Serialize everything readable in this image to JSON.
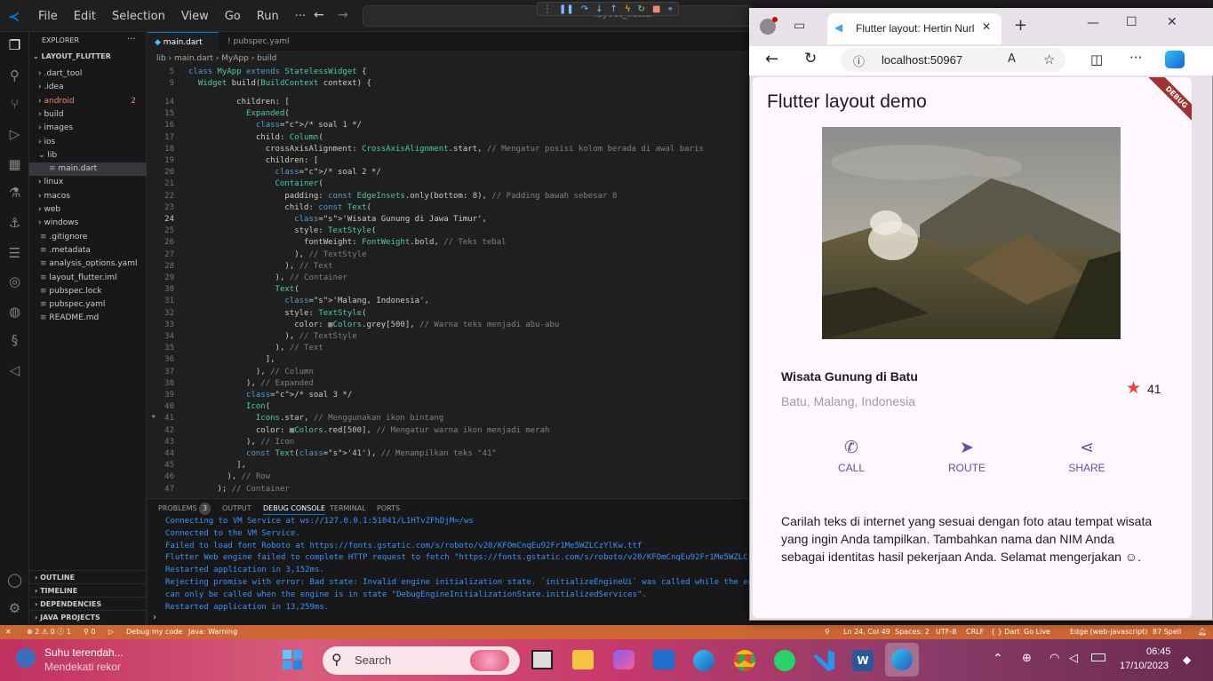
{
  "vscode": {
    "menu": [
      "File",
      "Edit",
      "Selection",
      "View",
      "Go",
      "Run",
      "···"
    ],
    "command_center": "layout_flutter",
    "explorer_title": "EXPLORER",
    "project": "LAYOUT_FLUTTER",
    "tree": [
      {
        "label": ".dart_tool",
        "kind": "folder"
      },
      {
        "label": ".idea",
        "kind": "folder"
      },
      {
        "label": "android",
        "kind": "folder",
        "badge": "2",
        "color": "#f48771"
      },
      {
        "label": "build",
        "kind": "folder"
      },
      {
        "label": "images",
        "kind": "folder"
      },
      {
        "label": "ios",
        "kind": "folder"
      },
      {
        "label": "lib",
        "kind": "folder-open"
      },
      {
        "label": "main.dart",
        "kind": "file-active"
      },
      {
        "label": "linux",
        "kind": "folder"
      },
      {
        "label": "macos",
        "kind": "folder"
      },
      {
        "label": "web",
        "kind": "folder"
      },
      {
        "label": "windows",
        "kind": "folder"
      },
      {
        "label": ".gitignore",
        "kind": "file"
      },
      {
        "label": ".metadata",
        "kind": "file"
      },
      {
        "label": "analysis_options.yaml",
        "kind": "file"
      },
      {
        "label": "layout_flutter.iml",
        "kind": "file"
      },
      {
        "label": "pubspec.lock",
        "kind": "file"
      },
      {
        "label": "pubspec.yaml",
        "kind": "file"
      },
      {
        "label": "README.md",
        "kind": "file"
      }
    ],
    "sections": [
      "OUTLINE",
      "TIMELINE",
      "DEPENDENCIES",
      "JAVA PROJECTS"
    ],
    "tabs": [
      {
        "label": "main.dart",
        "active": true
      },
      {
        "label": "pubspec.yaml",
        "active": false
      }
    ],
    "breadcrumbs": "lib  ›  main.dart  ›  MyApp  ›  build",
    "sticky": [
      {
        "n": "5",
        "text": "class MyApp extends StatelessWidget {"
      },
      {
        "n": "9",
        "text": "  Widget build(BuildContext context) {"
      }
    ],
    "code": [
      {
        "n": "14",
        "text": "          children: ["
      },
      {
        "n": "15",
        "text": "            Expanded("
      },
      {
        "n": "16",
        "text": "              /* soal 1 */"
      },
      {
        "n": "17",
        "text": "              child: Column("
      },
      {
        "n": "18",
        "text": "                crossAxisAlignment: CrossAxisAlignment.start, // Mengatur posisi kolom berada di awal baris"
      },
      {
        "n": "19",
        "text": "                children: ["
      },
      {
        "n": "20",
        "text": "                  /* soal 2 */"
      },
      {
        "n": "21",
        "text": "                  Container("
      },
      {
        "n": "22",
        "text": "                    padding: const EdgeInsets.only(bottom: 8), // Padding bawah sebesar 8"
      },
      {
        "n": "23",
        "text": "                    child: const Text("
      },
      {
        "n": "24",
        "text": "                      'Wisata Gunung di Jawa Timur',"
      },
      {
        "n": "25",
        "text": "                      style: TextStyle("
      },
      {
        "n": "26",
        "text": "                        fontWeight: FontWeight.bold, // Teks tebal"
      },
      {
        "n": "27",
        "text": "                      ), // TextStyle"
      },
      {
        "n": "28",
        "text": "                    ), // Text"
      },
      {
        "n": "29",
        "text": "                  ), // Container"
      },
      {
        "n": "30",
        "text": "                  Text("
      },
      {
        "n": "31",
        "text": "                    'Malang, Indonesia',"
      },
      {
        "n": "32",
        "text": "                    style: TextStyle("
      },
      {
        "n": "33",
        "text": "                      color: ■Colors.grey[500], // Warna teks menjadi abu-abu"
      },
      {
        "n": "34",
        "text": "                    ), // TextStyle"
      },
      {
        "n": "35",
        "text": "                  ), // Text"
      },
      {
        "n": "36",
        "text": "                ],"
      },
      {
        "n": "37",
        "text": "              ), // Column"
      },
      {
        "n": "38",
        "text": "            ), // Expanded"
      },
      {
        "n": "39",
        "text": "            /* soal 3 */"
      },
      {
        "n": "40",
        "text": "            Icon("
      },
      {
        "n": "41",
        "text": "              Icons.star, // Menggunakan ikon bintang"
      },
      {
        "n": "42",
        "text": "              color: ■Colors.red[500], // Mengatur warna ikon menjadi merah"
      },
      {
        "n": "43",
        "text": "            ), // Icon"
      },
      {
        "n": "44",
        "text": "            const Text('41'), // Menampilkan teks \"41\""
      },
      {
        "n": "45",
        "text": "          ],"
      },
      {
        "n": "46",
        "text": "        ), // Row"
      },
      {
        "n": "47",
        "text": "      ); // Container"
      }
    ],
    "panel_tabs": [
      "PROBLEMS",
      "3",
      "OUTPUT",
      "DEBUG CONSOLE",
      "TERMINAL",
      "PORTS"
    ],
    "console": [
      "Connecting to VM Service at ws://127.0.0.1:51041/L1HTvZFhDjM=/ws",
      "Connected to the VM Service.",
      "Failed to load font Roboto at https://fonts.gstatic.com/s/roboto/v20/KFOmCnqEu92Fr1Me5WZLCzYlKw.ttf",
      "Flutter Web engine failed to complete HTTP request to fetch \"https://fonts.gstatic.com/s/roboto/v20/KFOmCnqEu92Fr1Me5WZLCzYl",
      "Restarted application in 3,152ms.",
      "Rejecting promise with error: Bad state: Invalid engine initialization state. `initializeEngineUi` was called while the eng",
      "can only be called when the engine is in state \"DebugEngineInitializationState.initializedServices\".",
      "Restarted application in 13,259ms."
    ],
    "status": {
      "errors": "⊗ 2 ⚠ 0 ⓘ 1",
      "ports": "⚲ 0",
      "debug": "Debug my code",
      "java": "Java: Warning",
      "position": "Ln 24, Col 49",
      "spaces": "Spaces: 2",
      "encoding": "UTF-8",
      "eol": "CRLF",
      "lang": "{ } Dart",
      "golive": "Go Live",
      "device": "Edge (web-javascript)",
      "spell": "87 Spell"
    }
  },
  "browser": {
    "tab_title": "Flutter layout: Hertin Nurl",
    "url": "localhost:50967",
    "debug_banner": "DEBUG",
    "app_title": "Flutter layout demo",
    "place_title": "Wisata Gunung di Batu",
    "place_subtitle": "Batu, Malang, Indonesia",
    "rating": "41",
    "actions": [
      {
        "label": "CALL",
        "icon": "phone-icon"
      },
      {
        "label": "ROUTE",
        "icon": "near-me-icon"
      },
      {
        "label": "SHARE",
        "icon": "share-icon"
      }
    ],
    "description": "Carilah teks di internet yang sesuai dengan foto atau tempat wisata yang ingin Anda tampilkan. Tambahkan nama dan NIM Anda sebagai identitas hasil pekerjaan Anda. Selamat mengerjakan ☺.",
    "accent": "#6750a4",
    "star_color": "#f44336"
  },
  "taskbar": {
    "weather_title": "Suhu terendah...",
    "weather_sub": "Mendekati rekor",
    "search": "Search",
    "time": "06:45",
    "date": "17/10/2023"
  }
}
